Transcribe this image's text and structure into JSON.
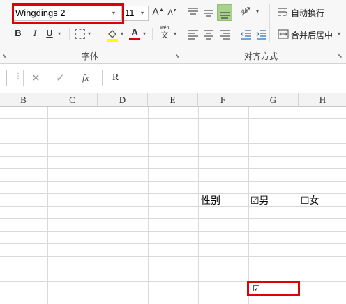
{
  "ribbon": {
    "font_group": {
      "font_name": "Wingdings 2",
      "font_size": "11",
      "grow_font": "A",
      "shrink_font": "A",
      "bold": "B",
      "italic": "I",
      "underline": "U",
      "font_color_glyph": "A",
      "phonetic_top": "wén",
      "phonetic_bottom": "文",
      "label": "字体"
    },
    "alignment_group": {
      "wrap_text": "自动换行",
      "merge_center": "合并后居中",
      "label": "对齐方式"
    },
    "colors": {
      "highlight_yellow": "#ffff00",
      "font_red": "#e00000",
      "accent_green": "#a9d08e"
    }
  },
  "formula_bar": {
    "cancel": "✕",
    "enter": "✓",
    "fx": "fx",
    "value": "R"
  },
  "sheet": {
    "columns": [
      "B",
      "C",
      "D",
      "E",
      "F",
      "G",
      "H"
    ],
    "cells": {
      "F_gender": "性别",
      "G_male": "☑男",
      "H_female": "☐女",
      "G_checkbox": "☑"
    }
  },
  "highlight_color": "#e00000"
}
